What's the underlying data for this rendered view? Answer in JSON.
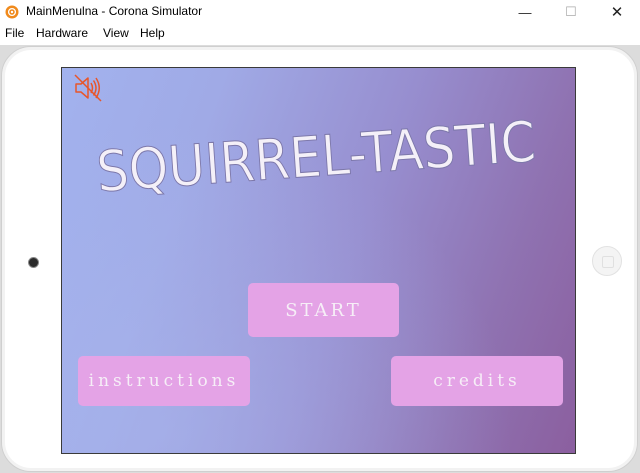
{
  "window": {
    "title": "MainMenulna - Corona Simulator",
    "icon": "corona-app-icon",
    "controls": {
      "minimize": "—",
      "maximize": "☐",
      "close": "✕"
    }
  },
  "menubar": {
    "items": [
      "File",
      "Hardware",
      "View",
      "Help"
    ]
  },
  "game": {
    "sound_icon": "speaker-muted-icon",
    "title": "SQUIRREL-TASTIC",
    "buttons": {
      "start": "START",
      "instructions": "instructions",
      "credits": "credits"
    }
  },
  "colors": {
    "button_fill": "#e4a3e6",
    "button_text": "#f6eef7",
    "background_left": "#a2b2ee",
    "background_right": "#8b5f9f",
    "sound_icon": "#e8562a"
  }
}
